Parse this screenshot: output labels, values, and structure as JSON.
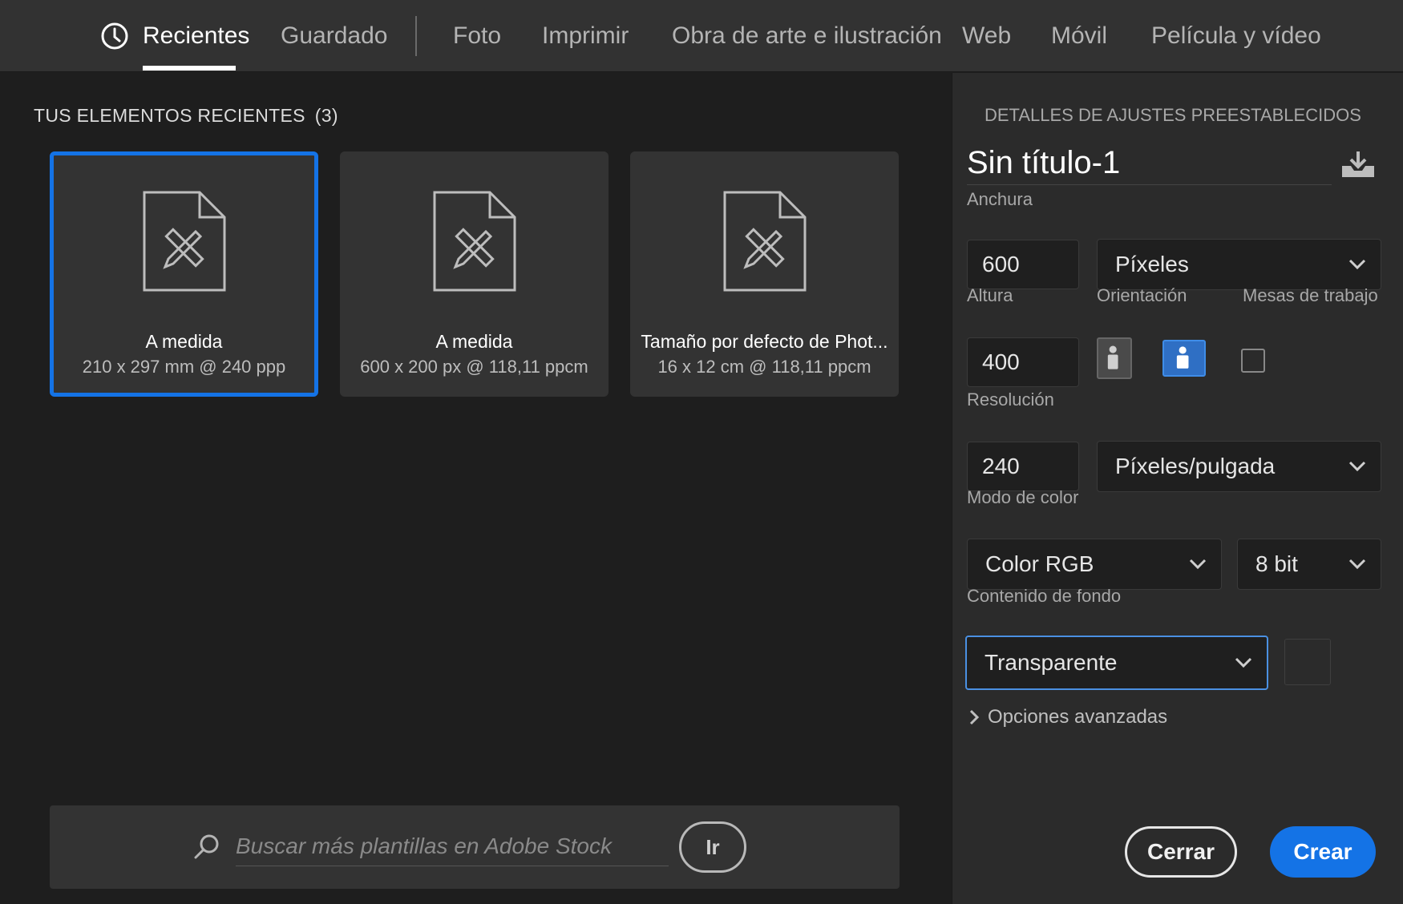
{
  "tabs": [
    {
      "label": "Recientes"
    },
    {
      "label": "Guardado"
    },
    {
      "label": "Foto"
    },
    {
      "label": "Imprimir"
    },
    {
      "label": "Obra de arte e ilustración"
    },
    {
      "label": "Web"
    },
    {
      "label": "Móvil"
    },
    {
      "label": "Película y vídeo"
    }
  ],
  "recent": {
    "title": "TUS ELEMENTOS RECIENTES",
    "count": "(3)",
    "items": [
      {
        "title": "A medida",
        "subtitle": "210 x 297 mm @ 240 ppp",
        "selected": true
      },
      {
        "title": "A medida",
        "subtitle": "600 x 200 px @ 118,11 ppcm",
        "selected": false
      },
      {
        "title": "Tamaño por defecto de Phot...",
        "subtitle": "16 x 12 cm @ 118,11 ppcm",
        "selected": false
      }
    ]
  },
  "search": {
    "placeholder": "Buscar más plantillas en Adobe Stock",
    "go_label": "Ir"
  },
  "details": {
    "title": "DETALLES DE AJUSTES PREESTABLECIDOS",
    "doc_name": "Sin título-1",
    "width_label": "Anchura",
    "width_value": "600",
    "width_unit": "Píxeles",
    "height_label": "Altura",
    "height_value": "400",
    "orientation_label": "Orientación",
    "artboards_label": "Mesas de trabajo",
    "resolution_label": "Resolución",
    "resolution_value": "240",
    "resolution_unit": "Píxeles/pulgada",
    "color_mode_label": "Modo de color",
    "color_mode_value": "Color RGB",
    "bit_depth_value": "8 bit",
    "background_label": "Contenido de fondo",
    "background_value": "Transparente",
    "advanced_label": "Opciones avanzadas",
    "close_label": "Cerrar",
    "create_label": "Crear"
  },
  "colors": {
    "accent": "#1473e6",
    "background": "#1e1e1e",
    "panel": "#2b2b2b",
    "card": "#333333"
  }
}
